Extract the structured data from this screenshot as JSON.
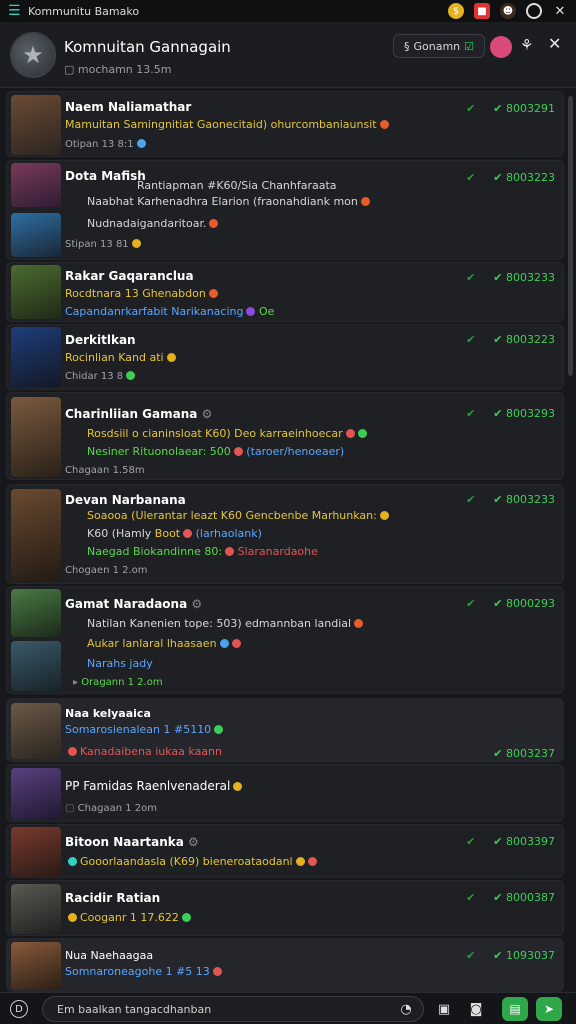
{
  "topbar": {
    "title": "Kommunitu Bamako"
  },
  "header": {
    "name": "Komnuitan Gannagain",
    "sub": "mochamn 13.5m",
    "button_label": "Gonamn"
  },
  "items": [
    {
      "name": "Naem Naliamathar",
      "line1": "Mamuitan Samingnitiat Gaonecitaid) ohurcombaniaunsit",
      "meta": "Otipan 13 8:1",
      "status": "8003291"
    },
    {
      "name": "Dota Mafish",
      "cat": "Rantiapman #K60/Sia Chanhfaraata",
      "line1": "Naabhat Karhenadhra Elarion (fraonahdiank mon",
      "line2": "Nudnadaigandaritoar.",
      "meta": "Stipan 13 81",
      "status": "8003223"
    },
    {
      "name": "Rakar Gaqaranclua",
      "line1": "Rocdtnara 13 Ghenabdon",
      "line2": "Capandanrkarfabit Narikanacing",
      "line2b": "Oe",
      "status": "8003233"
    },
    {
      "name": "Derkitlkan",
      "line1": "Rocinlian Kand ati",
      "meta": "Chidar 13 8",
      "status": "8003223"
    },
    {
      "name": "Charinliian Gamana",
      "line1": "Rosdsiil o cianinsloat K60) Deo karraeinhoecar",
      "line2": "Nesiner Rituonolaear: 500",
      "line2b": "(taroer/henoeaer)",
      "meta": "Chagaan 1.58m",
      "status": "8003293"
    },
    {
      "name": "Devan Narbanana",
      "line1": "Soaooa (Ulerantar leazt K60 Gencbenbe Marhunkan:",
      "line2": "K60 (Hamly",
      "line2b": "Boot",
      "line2c": "(larhaolank)",
      "line3": "Naegad Biokandinne 80:",
      "line3b": "Slaranardaohe",
      "meta": "Chogaen 1 2.om",
      "status": "8003233"
    },
    {
      "name": "Gamat Naradaona",
      "line1": "Natilan Kanenien tope: 503) edmannban landial",
      "line2": "Aukar lanlaral lhaasaen",
      "line3": "Narahs jady",
      "meta": "Oragann 1 2.om",
      "status": "8000293"
    },
    {
      "name": "Naa kelyaaica",
      "sub": "Somarosienalean 1 #5110",
      "line1": "Kanadaibena iukaa kaann",
      "status": "8003237"
    },
    {
      "name": "PP Famidas Raenlvenaderal",
      "meta": "Chagaan 1 2om"
    },
    {
      "name": "Bitoon Naartanka",
      "line1": "Gooorlaandasla (K69) bieneroataodanl",
      "status": "8003397"
    },
    {
      "name": "Racidir Ratian",
      "line1": "Cooganr 1 17.622",
      "status": "8000387"
    },
    {
      "name": "Nua Naehaagaa",
      "line1": "Somnaroneagohe 1 #5 13",
      "status": "1093037"
    }
  ],
  "composer": {
    "placeholder": "Em baalkan tangacdhanban"
  },
  "colors": {
    "accent_green": "#3ccf55",
    "accent_teal": "#2fd3c2",
    "background": "#17181b"
  }
}
